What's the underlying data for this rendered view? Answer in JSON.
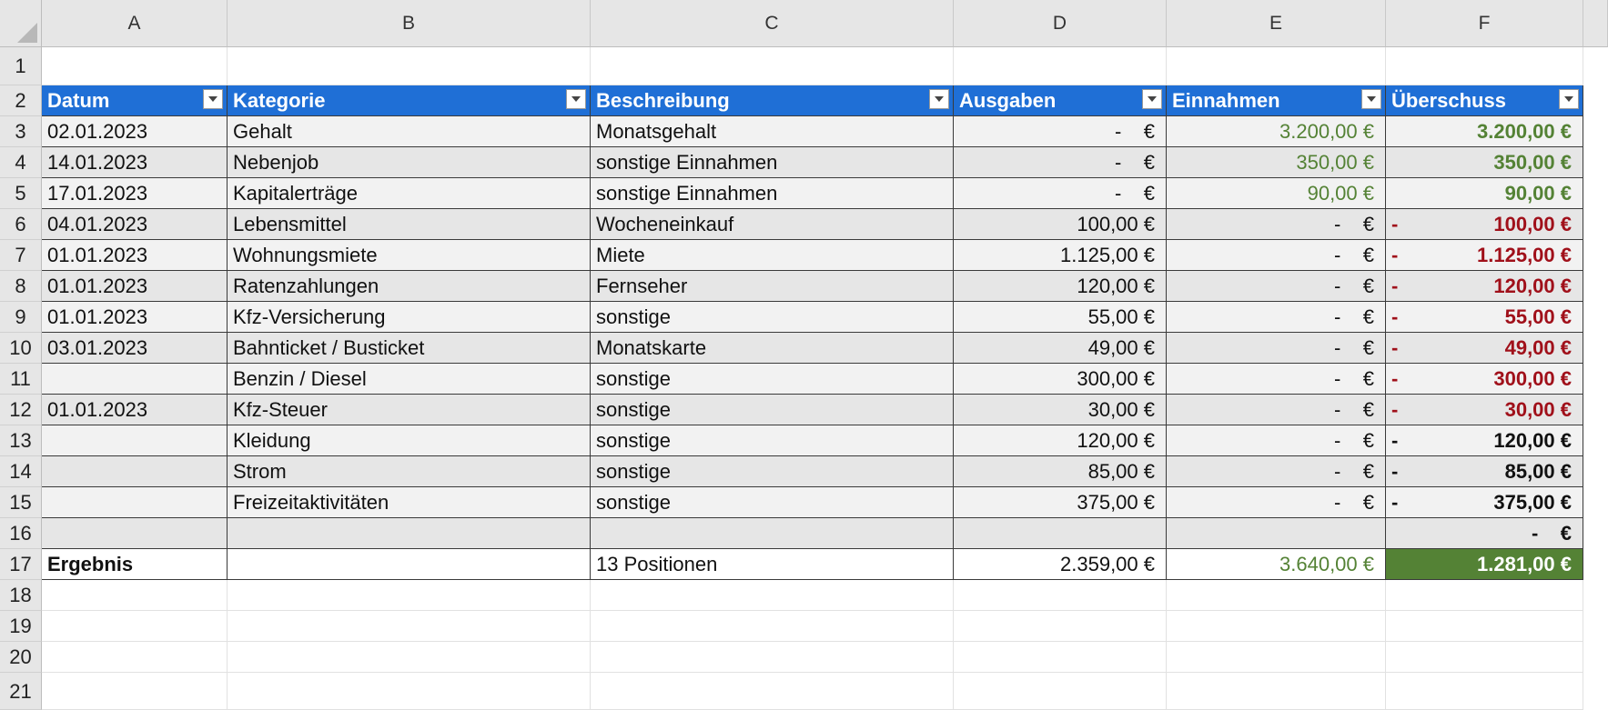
{
  "columns": [
    "A",
    "B",
    "C",
    "D",
    "E",
    "F"
  ],
  "rows": [
    "1",
    "2",
    "3",
    "4",
    "5",
    "6",
    "7",
    "8",
    "9",
    "10",
    "11",
    "12",
    "13",
    "14",
    "15",
    "16",
    "17",
    "18",
    "19",
    "20",
    "21"
  ],
  "table": {
    "headers": [
      "Datum",
      "Kategorie",
      "Beschreibung",
      "Ausgaben",
      "Einnahmen",
      "Überschuss"
    ],
    "data": [
      {
        "datum": "02.01.2023",
        "kategorie": "Gehalt",
        "beschreibung": "Monatsgehalt",
        "ausgaben": "-    €",
        "einnahmen": "3.200,00 €",
        "ueberschuss": "3.200,00 €",
        "sign": "",
        "tone": "green"
      },
      {
        "datum": "14.01.2023",
        "kategorie": "Nebenjob",
        "beschreibung": "sonstige Einnahmen",
        "ausgaben": "-    €",
        "einnahmen": "350,00 €",
        "ueberschuss": "350,00 €",
        "sign": "",
        "tone": "green"
      },
      {
        "datum": "17.01.2023",
        "kategorie": "Kapitalerträge",
        "beschreibung": "sonstige Einnahmen",
        "ausgaben": "-    €",
        "einnahmen": "90,00 €",
        "ueberschuss": "90,00 €",
        "sign": "",
        "tone": "green"
      },
      {
        "datum": "04.01.2023",
        "kategorie": "Lebensmittel",
        "beschreibung": "Wocheneinkauf",
        "ausgaben": "100,00 €",
        "einnahmen": "-    €",
        "ueberschuss": "100,00 €",
        "sign": "-",
        "tone": "red"
      },
      {
        "datum": "01.01.2023",
        "kategorie": "Wohnungsmiete",
        "beschreibung": "Miete",
        "ausgaben": "1.125,00 €",
        "einnahmen": "-    €",
        "ueberschuss": "1.125,00 €",
        "sign": "-",
        "tone": "red"
      },
      {
        "datum": "01.01.2023",
        "kategorie": "Ratenzahlungen",
        "beschreibung": "Fernseher",
        "ausgaben": "120,00 €",
        "einnahmen": "-    €",
        "ueberschuss": "120,00 €",
        "sign": "-",
        "tone": "red"
      },
      {
        "datum": "01.01.2023",
        "kategorie": "Kfz-Versicherung",
        "beschreibung": "sonstige",
        "ausgaben": "55,00 €",
        "einnahmen": "-    €",
        "ueberschuss": "55,00 €",
        "sign": "-",
        "tone": "red"
      },
      {
        "datum": "03.01.2023",
        "kategorie": "Bahnticket / Busticket",
        "beschreibung": "Monatskarte",
        "ausgaben": "49,00 €",
        "einnahmen": "-    €",
        "ueberschuss": "49,00 €",
        "sign": "-",
        "tone": "red"
      },
      {
        "datum": "",
        "kategorie": "Benzin / Diesel",
        "beschreibung": "sonstige",
        "ausgaben": "300,00 €",
        "einnahmen": "-    €",
        "ueberschuss": "300,00 €",
        "sign": "-",
        "tone": "red"
      },
      {
        "datum": "01.01.2023",
        "kategorie": "Kfz-Steuer",
        "beschreibung": "sonstige",
        "ausgaben": "30,00 €",
        "einnahmen": "-    €",
        "ueberschuss": "30,00 €",
        "sign": "-",
        "tone": "red"
      },
      {
        "datum": "",
        "kategorie": "Kleidung",
        "beschreibung": "sonstige",
        "ausgaben": "120,00 €",
        "einnahmen": "-    €",
        "ueberschuss": "120,00 €",
        "sign": "-",
        "tone": "black"
      },
      {
        "datum": "",
        "kategorie": "Strom",
        "beschreibung": "sonstige",
        "ausgaben": "85,00 €",
        "einnahmen": "-    €",
        "ueberschuss": "85,00 €",
        "sign": "-",
        "tone": "black"
      },
      {
        "datum": "",
        "kategorie": "Freizeitaktivitäten",
        "beschreibung": "sonstige",
        "ausgaben": "375,00 €",
        "einnahmen": "-    €",
        "ueberschuss": "375,00 €",
        "sign": "-",
        "tone": "black"
      },
      {
        "datum": "",
        "kategorie": "",
        "beschreibung": "",
        "ausgaben": "",
        "einnahmen": "",
        "ueberschuss": "-    €",
        "sign": "",
        "tone": "black"
      }
    ],
    "total": {
      "label": "Ergebnis",
      "kategorie": "",
      "beschreibung": "13 Positionen",
      "ausgaben": "2.359,00 €",
      "einnahmen": "3.640,00 €",
      "ueberschuss": "1.281,00 €"
    }
  },
  "colors": {
    "header": "#1f6fd6",
    "green": "#548235",
    "red": "#a0101a",
    "total_fill": "#548235"
  }
}
